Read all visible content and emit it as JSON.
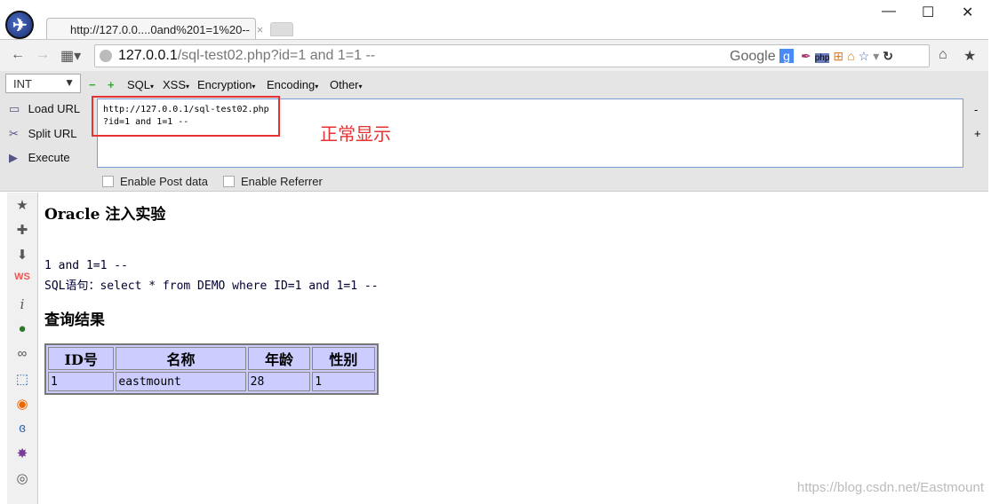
{
  "tab": {
    "title": "http://127.0.0....0and%201=1%20--",
    "close": "×"
  },
  "window": {
    "minimize": "—",
    "maximize": "☐",
    "close": "✕"
  },
  "nav": {
    "back": "←",
    "forward": "→",
    "grid": "▦▾",
    "url_host": "127.0.0.1",
    "url_path": "/sql-test02.php?id=1 and 1=1 --",
    "search_engine": "Google",
    "g": "g",
    "home": "⌂",
    "star": "★",
    "reload": "↻",
    "bookmark": "☆",
    "dropdown": "▾"
  },
  "hackbar": {
    "select": "INT",
    "menus": [
      "SQL",
      "XSS",
      "Encryption",
      "Encoding",
      "Other"
    ],
    "load": "Load URL",
    "split": "Split URL",
    "execute": "Execute",
    "text": "http://127.0.0.1/sql-test02.php\n?id=1 and 1=1 --",
    "minus": "-",
    "plus": "+",
    "post": "Enable Post data",
    "referrer": "Enable Referrer"
  },
  "annotation": "正常显示",
  "page": {
    "title": "Oracle 注入实验",
    "line1": "1 and 1=1 --",
    "line2": "SQL语句：select * from DEMO where ID=1 and 1=1 --",
    "result_heading": "查询结果",
    "table": {
      "headers": [
        "ID号",
        "名称",
        "年龄",
        "性别"
      ],
      "rows": [
        [
          "1",
          "eastmount",
          "28",
          "1"
        ]
      ]
    }
  },
  "watermark": "https://blog.csdn.net/Eastmount"
}
